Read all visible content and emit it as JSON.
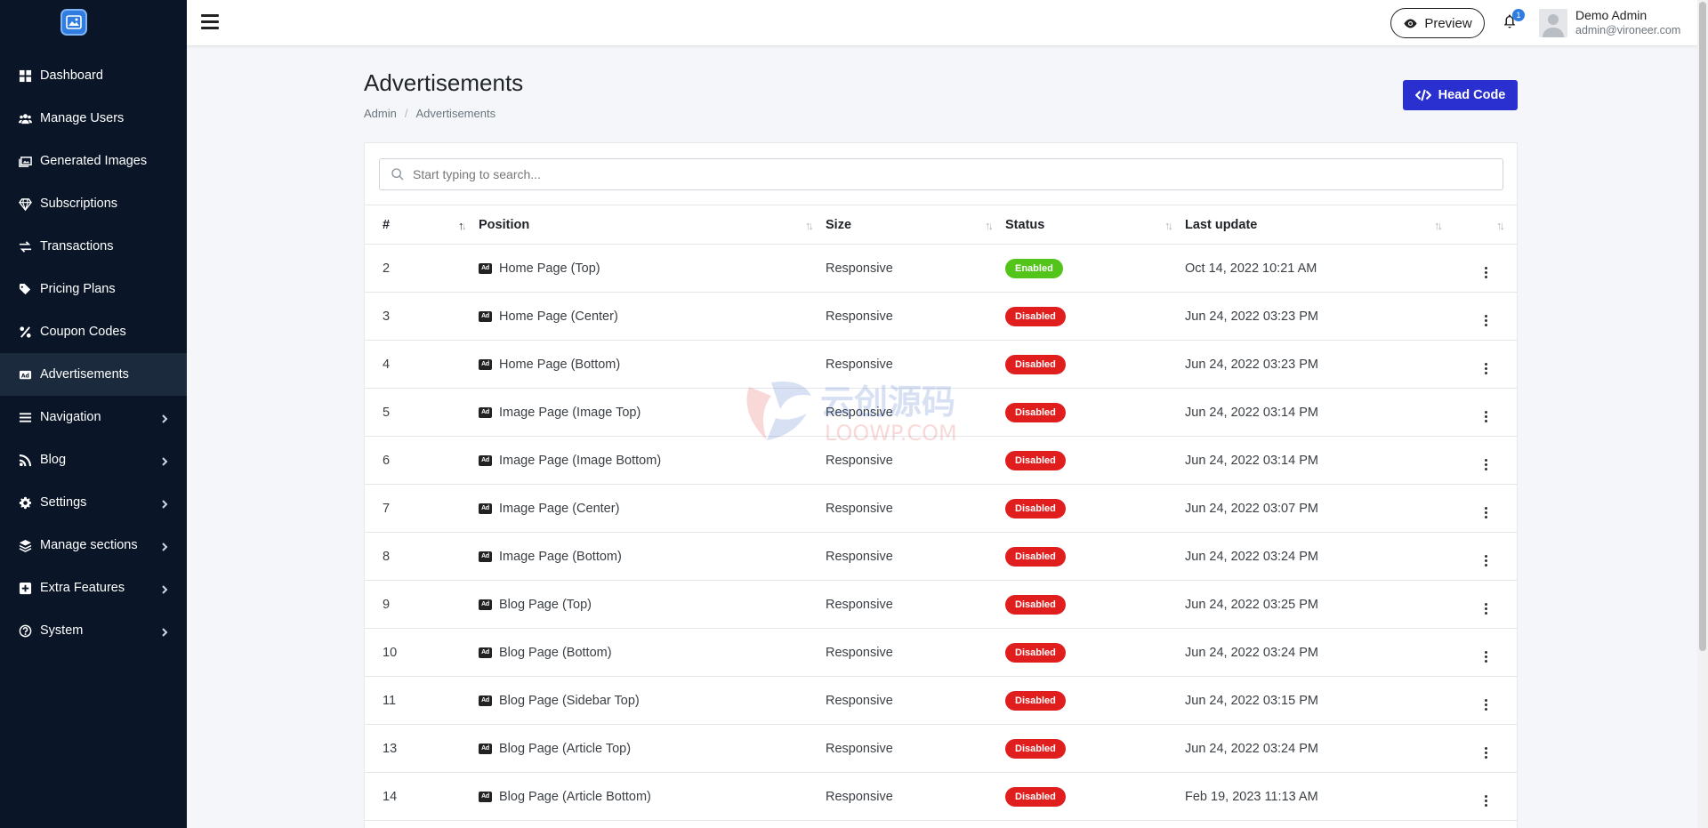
{
  "sidebar": {
    "items": [
      {
        "label": "Dashboard",
        "icon": "dashboard-icon",
        "has_chevron": false,
        "active": false
      },
      {
        "label": "Manage Users",
        "icon": "users-icon",
        "has_chevron": false,
        "active": false
      },
      {
        "label": "Generated Images",
        "icon": "images-icon",
        "has_chevron": false,
        "active": false
      },
      {
        "label": "Subscriptions",
        "icon": "diamond-icon",
        "has_chevron": false,
        "active": false
      },
      {
        "label": "Transactions",
        "icon": "exchange-icon",
        "has_chevron": false,
        "active": false
      },
      {
        "label": "Pricing Plans",
        "icon": "tags-icon",
        "has_chevron": false,
        "active": false
      },
      {
        "label": "Coupon Codes",
        "icon": "percent-icon",
        "has_chevron": false,
        "active": false
      },
      {
        "label": "Advertisements",
        "icon": "ad-icon",
        "has_chevron": false,
        "active": true
      },
      {
        "label": "Navigation",
        "icon": "bars-icon",
        "has_chevron": true,
        "active": false
      },
      {
        "label": "Blog",
        "icon": "rss-icon",
        "has_chevron": true,
        "active": false
      },
      {
        "label": "Settings",
        "icon": "gear-icon",
        "has_chevron": true,
        "active": false
      },
      {
        "label": "Manage sections",
        "icon": "layers-icon",
        "has_chevron": true,
        "active": false
      },
      {
        "label": "Extra Features",
        "icon": "plus-square-icon",
        "has_chevron": true,
        "active": false
      },
      {
        "label": "System",
        "icon": "question-circle-icon",
        "has_chevron": true,
        "active": false
      }
    ]
  },
  "topbar": {
    "preview_label": "Preview",
    "notification_count": "1",
    "user_name": "Demo Admin",
    "user_email": "admin@vironeer.com"
  },
  "page": {
    "title": "Advertisements",
    "breadcrumb": [
      "Admin",
      "Advertisements"
    ],
    "head_code_label": "Head Code"
  },
  "search": {
    "placeholder": "Start typing to search..."
  },
  "table": {
    "headers": [
      "#",
      "Position",
      "Size",
      "Status",
      "Last update"
    ],
    "rows": [
      {
        "id": "2",
        "position": "Home Page (Top)",
        "size": "Responsive",
        "status": "Enabled",
        "updated": "Oct 14, 2022 10:21 AM"
      },
      {
        "id": "3",
        "position": "Home Page (Center)",
        "size": "Responsive",
        "status": "Disabled",
        "updated": "Jun 24, 2022 03:23 PM"
      },
      {
        "id": "4",
        "position": "Home Page (Bottom)",
        "size": "Responsive",
        "status": "Disabled",
        "updated": "Jun 24, 2022 03:23 PM"
      },
      {
        "id": "5",
        "position": "Image Page (Image Top)",
        "size": "Responsive",
        "status": "Disabled",
        "updated": "Jun 24, 2022 03:14 PM"
      },
      {
        "id": "6",
        "position": "Image Page (Image Bottom)",
        "size": "Responsive",
        "status": "Disabled",
        "updated": "Jun 24, 2022 03:14 PM"
      },
      {
        "id": "7",
        "position": "Image Page (Center)",
        "size": "Responsive",
        "status": "Disabled",
        "updated": "Jun 24, 2022 03:07 PM"
      },
      {
        "id": "8",
        "position": "Image Page (Bottom)",
        "size": "Responsive",
        "status": "Disabled",
        "updated": "Jun 24, 2022 03:24 PM"
      },
      {
        "id": "9",
        "position": "Blog Page (Top)",
        "size": "Responsive",
        "status": "Disabled",
        "updated": "Jun 24, 2022 03:25 PM"
      },
      {
        "id": "10",
        "position": "Blog Page (Bottom)",
        "size": "Responsive",
        "status": "Disabled",
        "updated": "Jun 24, 2022 03:24 PM"
      },
      {
        "id": "11",
        "position": "Blog Page (Sidebar Top)",
        "size": "Responsive",
        "status": "Disabled",
        "updated": "Jun 24, 2022 03:15 PM"
      },
      {
        "id": "13",
        "position": "Blog Page (Article Top)",
        "size": "Responsive",
        "status": "Disabled",
        "updated": "Jun 24, 2022 03:24 PM"
      },
      {
        "id": "14",
        "position": "Blog Page (Article Bottom)",
        "size": "Responsive",
        "status": "Disabled",
        "updated": "Feb 19, 2023 11:13 AM"
      }
    ]
  },
  "watermark": {
    "line1": "云创源码",
    "line2": "LOOWP.COM"
  },
  "colors": {
    "sidebar_bg": "#0a1628",
    "accent": "#2a2fcf",
    "enabled": "#52c41a",
    "disabled": "#e01e1e"
  }
}
